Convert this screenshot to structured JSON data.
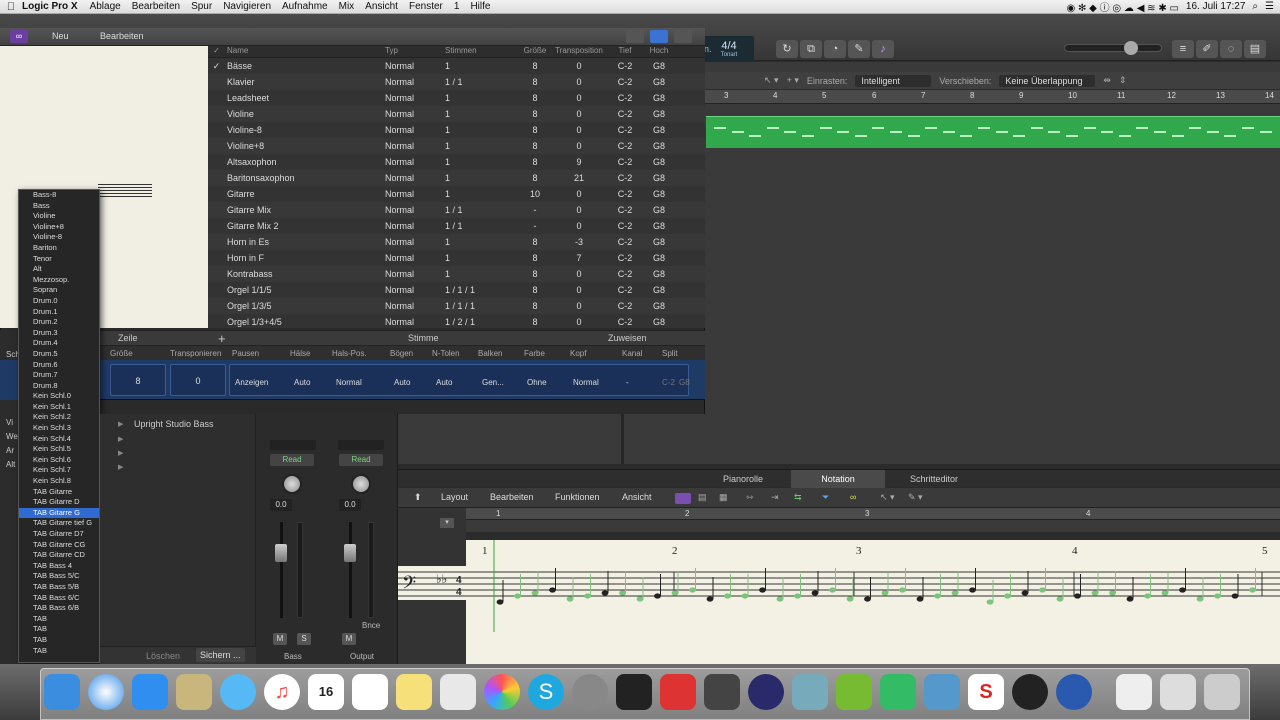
{
  "menubar": {
    "app": "Logic Pro X",
    "items": [
      "Ablage",
      "Bearbeiten",
      "Spur",
      "Navigieren",
      "Aufnahme",
      "Mix",
      "Ansicht",
      "Fenster",
      "1",
      "Hilfe"
    ],
    "clock": "16. Juli  17:27"
  },
  "top": {
    "lcd_bar": "4/4",
    "lcd_label": "Tonart",
    "lcd_left": "n."
  },
  "arrange": {
    "snap_label": "Einrasten:",
    "snap_value": "Intelligent",
    "move_label": "Verschieben:",
    "move_value": "Keine Überlappung",
    "ruler": [
      "3",
      "4",
      "5",
      "6",
      "7",
      "8",
      "9",
      "10",
      "11",
      "12",
      "13",
      "14"
    ]
  },
  "scoreset": {
    "new_label": "Neu",
    "edit_label": "Bearbeiten",
    "headers": [
      "Name",
      "Typ",
      "Stimmen",
      "Größe",
      "Transposition",
      "Tief",
      "Hoch"
    ],
    "rows": [
      {
        "chk": "✓",
        "name": "Bässe",
        "typ": "Normal",
        "st": "1",
        "gr": "8",
        "tp": "0",
        "tf": "C-2",
        "ho": "G8"
      },
      {
        "chk": "",
        "name": "Klavier",
        "typ": "Normal",
        "st": "1 / 1",
        "gr": "8",
        "tp": "0",
        "tf": "C-2",
        "ho": "G8"
      },
      {
        "chk": "",
        "name": "Leadsheet",
        "typ": "Normal",
        "st": "1",
        "gr": "8",
        "tp": "0",
        "tf": "C-2",
        "ho": "G8"
      },
      {
        "chk": "",
        "name": "Violine",
        "typ": "Normal",
        "st": "1",
        "gr": "8",
        "tp": "0",
        "tf": "C-2",
        "ho": "G8"
      },
      {
        "chk": "",
        "name": "Violine-8",
        "typ": "Normal",
        "st": "1",
        "gr": "8",
        "tp": "0",
        "tf": "C-2",
        "ho": "G8"
      },
      {
        "chk": "",
        "name": "Violine+8",
        "typ": "Normal",
        "st": "1",
        "gr": "8",
        "tp": "0",
        "tf": "C-2",
        "ho": "G8"
      },
      {
        "chk": "",
        "name": "Altsaxophon",
        "typ": "Normal",
        "st": "1",
        "gr": "8",
        "tp": "9",
        "tf": "C-2",
        "ho": "G8"
      },
      {
        "chk": "",
        "name": "Baritonsaxophon",
        "typ": "Normal",
        "st": "1",
        "gr": "8",
        "tp": "21",
        "tf": "C-2",
        "ho": "G8"
      },
      {
        "chk": "",
        "name": "Gitarre",
        "typ": "Normal",
        "st": "1",
        "gr": "10",
        "tp": "0",
        "tf": "C-2",
        "ho": "G8"
      },
      {
        "chk": "",
        "name": "Gitarre Mix",
        "typ": "Normal",
        "st": "1 / 1",
        "gr": "-",
        "tp": "0",
        "tf": "C-2",
        "ho": "G8"
      },
      {
        "chk": "",
        "name": "Gitarre Mix 2",
        "typ": "Normal",
        "st": "1 / 1",
        "gr": "-",
        "tp": "0",
        "tf": "C-2",
        "ho": "G8"
      },
      {
        "chk": "",
        "name": "Horn in Es",
        "typ": "Normal",
        "st": "1",
        "gr": "8",
        "tp": "-3",
        "tf": "C-2",
        "ho": "G8"
      },
      {
        "chk": "",
        "name": "Horn in F",
        "typ": "Normal",
        "st": "1",
        "gr": "8",
        "tp": "7",
        "tf": "C-2",
        "ho": "G8"
      },
      {
        "chk": "",
        "name": "Kontrabass",
        "typ": "Normal",
        "st": "1",
        "gr": "8",
        "tp": "0",
        "tf": "C-2",
        "ho": "G8"
      },
      {
        "chk": "",
        "name": "Orgel 1/1/5",
        "typ": "Normal",
        "st": "1 / 1 / 1",
        "gr": "8",
        "tp": "0",
        "tf": "C-2",
        "ho": "G8"
      },
      {
        "chk": "",
        "name": "Orgel 1/3/5",
        "typ": "Normal",
        "st": "1 / 1 / 1",
        "gr": "8",
        "tp": "0",
        "tf": "C-2",
        "ho": "G8"
      },
      {
        "chk": "",
        "name": "Orgel 1/3+4/5",
        "typ": "Normal",
        "st": "1 / 2 / 1",
        "gr": "8",
        "tp": "0",
        "tf": "C-2",
        "ho": "G8"
      }
    ],
    "split_row": "Zeile",
    "split_voice": "Stimme",
    "split_assign": "Zuweisen",
    "param_headers": [
      "Größe",
      "Transponieren",
      "Pausen",
      "Hälse",
      "Hals-Pos.",
      "Bögen",
      "N-Tolen",
      "Balken",
      "Farbe",
      "Kopf",
      "Kanal",
      "Split"
    ],
    "param_size": "8",
    "param_transp": "0",
    "param_values": [
      "Anzeigen",
      "Auto",
      "Normal",
      "Auto",
      "Auto",
      "Gen...",
      "Ohne",
      "Normal",
      "-",
      "C-2",
      "G8"
    ],
    "left_label": "Sch"
  },
  "clef_menu": [
    "Bass-8",
    "Bass",
    "Violine",
    "Violine+8",
    "Violine-8",
    "Bariton",
    "Tenor",
    "Alt",
    "Mezzosop.",
    "Sopran",
    "Drum.0",
    "Drum.1",
    "Drum.2",
    "Drum.3",
    "Drum.4",
    "Drum.5",
    "Drum.6",
    "Drum.7",
    "Drum.8",
    "Kein Schl.0",
    "Kein Schl.1",
    "Kein Schl.2",
    "Kein Schl.3",
    "Kein Schl.4",
    "Kein Schl.5",
    "Kein Schl.6",
    "Kein Schl.7",
    "Kein Schl.8",
    "TAB Gitarre",
    "TAB Gitarre D",
    "TAB Gitarre G",
    "TAB Gitarre tief G",
    "TAB Gitarre D7",
    "TAB Gitarre CG",
    "TAB Gitarre CD",
    "TAB Bass 4",
    "TAB Bass 5/C",
    "TAB Bass 5/B",
    "TAB Bass 6/C",
    "TAB Bass 6/B",
    "TAB",
    "TAB",
    "TAB",
    "TAB"
  ],
  "clef_menu_selected": 30,
  "library": {
    "item": "Upright Studio Bass",
    "delete": "Löschen",
    "save": "Sichern ...",
    "side_labels": [
      "Vi",
      "We",
      "Ar",
      "Alt"
    ]
  },
  "mixer": {
    "read1": "Read",
    "read2": "Read",
    "val1": "0.0",
    "val2": "0.0",
    "m": "M",
    "s": "S",
    "bnce": "Bnce",
    "label1": "Bass",
    "label2": "Output"
  },
  "editor": {
    "tabs": [
      "Pianorolle",
      "Notation",
      "Schritteditor"
    ],
    "active_tab": "Notation",
    "menus": [
      "Layout",
      "Bearbeiten",
      "Funktionen",
      "Ansicht"
    ],
    "ruler": [
      "1",
      "2",
      "3",
      "4"
    ],
    "bar_numbers": [
      "1",
      "2",
      "3",
      "4",
      "5"
    ]
  },
  "dock": {
    "cal_day": "16",
    "cal_month": "JUL"
  },
  "colors": {
    "region_green": "#32a84c",
    "selection_blue": "#2f6bd1",
    "param_blue": "#203a66"
  }
}
